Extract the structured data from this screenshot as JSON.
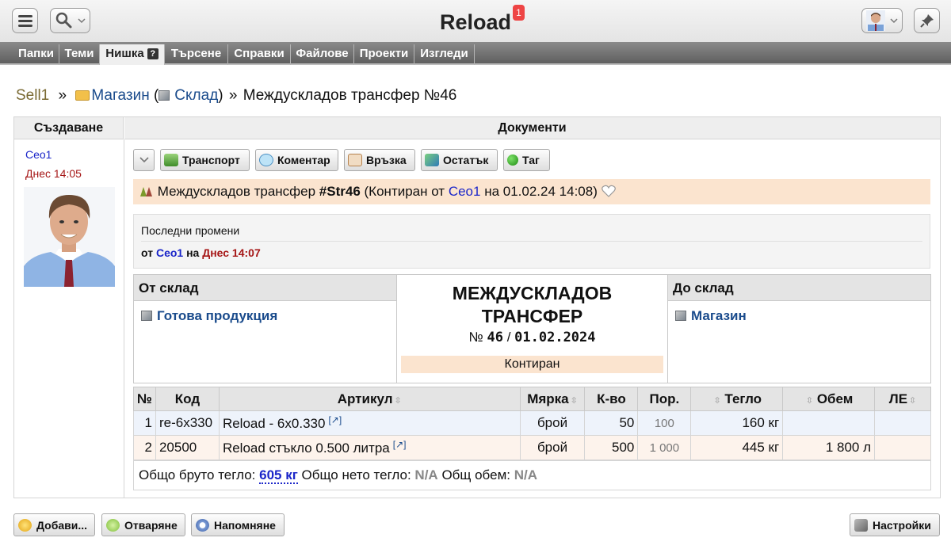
{
  "app": {
    "title": "Reload",
    "notifications": "1"
  },
  "tabs": [
    "Папки",
    "Теми",
    "Нишка",
    "Търсене",
    "Справки",
    "Файлове",
    "Проекти",
    "Изгледи"
  ],
  "tab_help": "?",
  "breadcrumb": {
    "root": "Sell1",
    "sep1": "»",
    "folder": "Магазин",
    "paren_open": "(",
    "store": "Склад",
    "paren_close": ")",
    "sep2": "»",
    "current": "Междускладов трансфер №46"
  },
  "columns": {
    "left": "Създаване",
    "right": "Документи"
  },
  "creator": {
    "name": "Ceo1",
    "time": "Днес 14:05"
  },
  "toolbar": {
    "transport": "Транспорт",
    "comment": "Коментар",
    "link": "Връзка",
    "balance": "Остатък",
    "tag": "Таг"
  },
  "doc": {
    "title_prefix": "Междускладов трансфер",
    "handle": "#Str46",
    "posted_prefix": "(Контиран от",
    "posted_by": "Ceo1",
    "posted_suffix": "на 01.02.24 14:08)"
  },
  "changes": {
    "title": "Последни промени",
    "from": "от",
    "user": "Ceo1",
    "on": "на",
    "date": "Днес 14:07"
  },
  "from_store": {
    "label": "От склад",
    "value": "Готова продукция"
  },
  "to_store": {
    "label": "До склад",
    "value": "Магазин"
  },
  "doc_center": {
    "heading_line1": "МЕЖДУСКЛАДОВ",
    "heading_line2": "ТРАНСФЕР",
    "no_sign": "№",
    "number": "46",
    "slash": "/",
    "date": "01.02.2024",
    "status": "Контиран"
  },
  "table": {
    "headers": {
      "no": "№",
      "code": "Код",
      "article": "Артикул",
      "unit": "Мярка",
      "qty": "К-во",
      "order": "Пор.",
      "weight": "Тегло",
      "volume": "Обем",
      "le": "ЛЕ"
    },
    "rows": [
      {
        "no": "1",
        "code": "re-6x330",
        "article": "Reload - 6x0.330",
        "unit": "брой",
        "qty": "50",
        "order": "100",
        "weight": "160 кг",
        "volume": "",
        "le": ""
      },
      {
        "no": "2",
        "code": "20500",
        "article": "Reload стъкло 0.500 литра",
        "unit": "брой",
        "qty": "500",
        "order": "1 000",
        "weight": "445 кг",
        "volume": "1 800 л",
        "le": ""
      }
    ]
  },
  "totals": {
    "gross_label": "Общо бруто тегло:",
    "gross_value": "605 кг",
    "net_label": "Общо нето тегло:",
    "net_value": "N/A",
    "vol_label": "Общ обем:",
    "vol_value": "N/A"
  },
  "bottom": {
    "add": "Добави...",
    "open": "Отваряне",
    "remind": "Напомняне",
    "settings": "Настройки"
  },
  "colors": {
    "accent": "#1a4b8c",
    "user": "#1b26c9",
    "date": "#a51515",
    "highlight": "#fbe4cf"
  }
}
